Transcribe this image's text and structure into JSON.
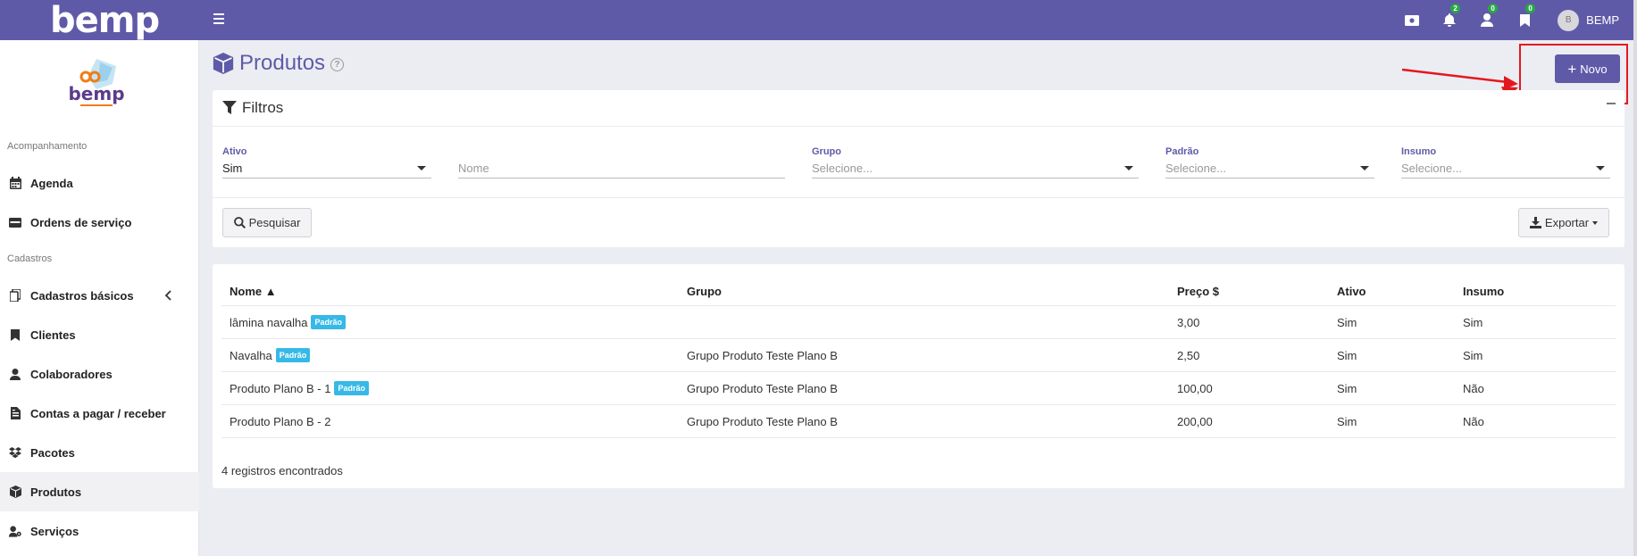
{
  "app": {
    "logo": "bemp"
  },
  "topbar": {
    "icons": [
      {
        "name": "cash-icon",
        "badge": ""
      },
      {
        "name": "bell-icon",
        "badge": "2"
      },
      {
        "name": "user-icon",
        "badge": "0"
      },
      {
        "name": "bookmark-icon",
        "badge": "0"
      }
    ],
    "user": {
      "initial": "B",
      "name": "BEMP"
    }
  },
  "sidebar": {
    "sections": [
      "Acompanhamento",
      "Cadastros"
    ],
    "items": [
      {
        "label": "Agenda",
        "icon": "calendar-icon"
      },
      {
        "label": "Ordens de serviço",
        "icon": "card-icon"
      },
      {
        "label": "Cadastros básicos",
        "icon": "copy-icon"
      },
      {
        "label": "Clientes",
        "icon": "bookmark-icon"
      },
      {
        "label": "Colaboradores",
        "icon": "user-icon"
      },
      {
        "label": "Contas a pagar / receber",
        "icon": "file-invoice-icon"
      },
      {
        "label": "Pacotes",
        "icon": "dropbox-icon"
      },
      {
        "label": "Produtos",
        "icon": "cube-icon"
      },
      {
        "label": "Serviços",
        "icon": "user-gear-icon"
      }
    ]
  },
  "page": {
    "title": "Produtos",
    "help": "?",
    "new_button": "Novo"
  },
  "filters": {
    "title": "Filtros",
    "ativo": {
      "label": "Ativo",
      "value": "Sim"
    },
    "nome": {
      "placeholder": "Nome"
    },
    "grupo": {
      "label": "Grupo",
      "placeholder": "Selecione..."
    },
    "padrao": {
      "label": "Padrão",
      "placeholder": "Selecione..."
    },
    "insumo": {
      "label": "Insumo",
      "placeholder": "Selecione..."
    },
    "search_button": "Pesquisar",
    "export_button": "Exportar"
  },
  "table": {
    "columns": [
      "Nome ▲",
      "Grupo",
      "Preço $",
      "Ativo",
      "Insumo"
    ],
    "rows": [
      {
        "nome": "lâmina navalha",
        "badge": "Padrão",
        "grupo": "",
        "preco": "3,00",
        "ativo": "Sim",
        "insumo": "Sim"
      },
      {
        "nome": "Navalha",
        "badge": "Padrão",
        "grupo": "Grupo Produto Teste Plano B",
        "preco": "2,50",
        "ativo": "Sim",
        "insumo": "Sim"
      },
      {
        "nome": "Produto Plano B - 1",
        "badge": "Padrão",
        "grupo": "Grupo Produto Teste Plano B",
        "preco": "100,00",
        "ativo": "Sim",
        "insumo": "Não"
      },
      {
        "nome": "Produto Plano B - 2",
        "badge": "",
        "grupo": "Grupo Produto Teste Plano B",
        "preco": "200,00",
        "ativo": "Sim",
        "insumo": "Não"
      }
    ],
    "footer": "4 registros encontrados"
  },
  "colors": {
    "primary": "#5f5aa8",
    "badge": "#36b9e6",
    "annotation": "#e4171f"
  }
}
